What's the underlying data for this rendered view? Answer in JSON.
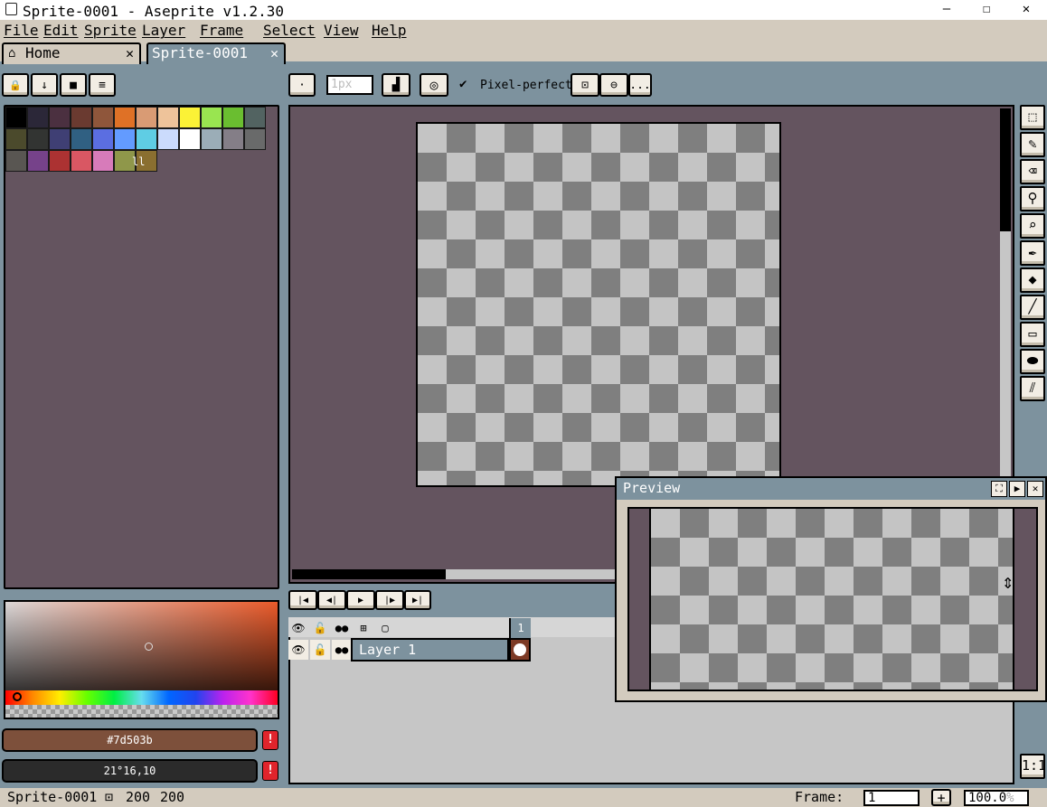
{
  "window": {
    "title": "Sprite-0001 - Aseprite v1.2.30",
    "minimize": "—",
    "maximize": "☐",
    "close": "✕"
  },
  "menu": [
    "File",
    "Edit",
    "Sprite",
    "Layer",
    "Frame",
    "Select",
    "View",
    "Help"
  ],
  "tabs": [
    {
      "label": "Home",
      "close": "✕"
    },
    {
      "label": "Sprite-0001",
      "close": "✕"
    }
  ],
  "palette_toolbar": {
    "lock": "🔒",
    "sort": "↓",
    "presets": "■",
    "options": "≡"
  },
  "brush_toolbar": {
    "brush_type": "·",
    "brush_size": "1px",
    "pixel_perfect": "Pixel-perfect",
    "more": "..."
  },
  "palette": {
    "colors": [
      "#000000",
      "#2b2738",
      "#4b3040",
      "#6a3a30",
      "#8f563b",
      "#df7126",
      "#d99b74",
      "#eec39a",
      "#fbf236",
      "#99e550",
      "#6abe30",
      "#526361",
      "#4b4a2c",
      "#323432",
      "#3f3f74",
      "#306082",
      "#5b6ee1",
      "#639bff",
      "#5fcde4",
      "#cbdbfc",
      "#ffffff",
      "#9badb7",
      "#847e87",
      "#696a6a",
      "#595652",
      "#76428a",
      "#ac3232",
      "#d95763",
      "#d77bba",
      "#8f974a",
      "#8a6f30"
    ],
    "more": "ll"
  },
  "colors": {
    "foreground": "#7d503b",
    "background": "21°16,10",
    "warning": "!"
  },
  "timeline": {
    "frame_number": "1",
    "layer_name": "Layer 1",
    "nav": [
      "|◀",
      "◀|",
      "▶",
      "|▶",
      "▶|"
    ]
  },
  "preview": {
    "title": "Preview",
    "maximize": "⛶",
    "play": "▶",
    "close": "✕"
  },
  "status": {
    "sprite_name": "Sprite-0001",
    "width": "200",
    "height": "200",
    "frame_label": "Frame:",
    "frame_value": "1",
    "add": "+",
    "zoom": "100.0",
    "zoom_unit": "%",
    "one_to_one": "1:1"
  }
}
